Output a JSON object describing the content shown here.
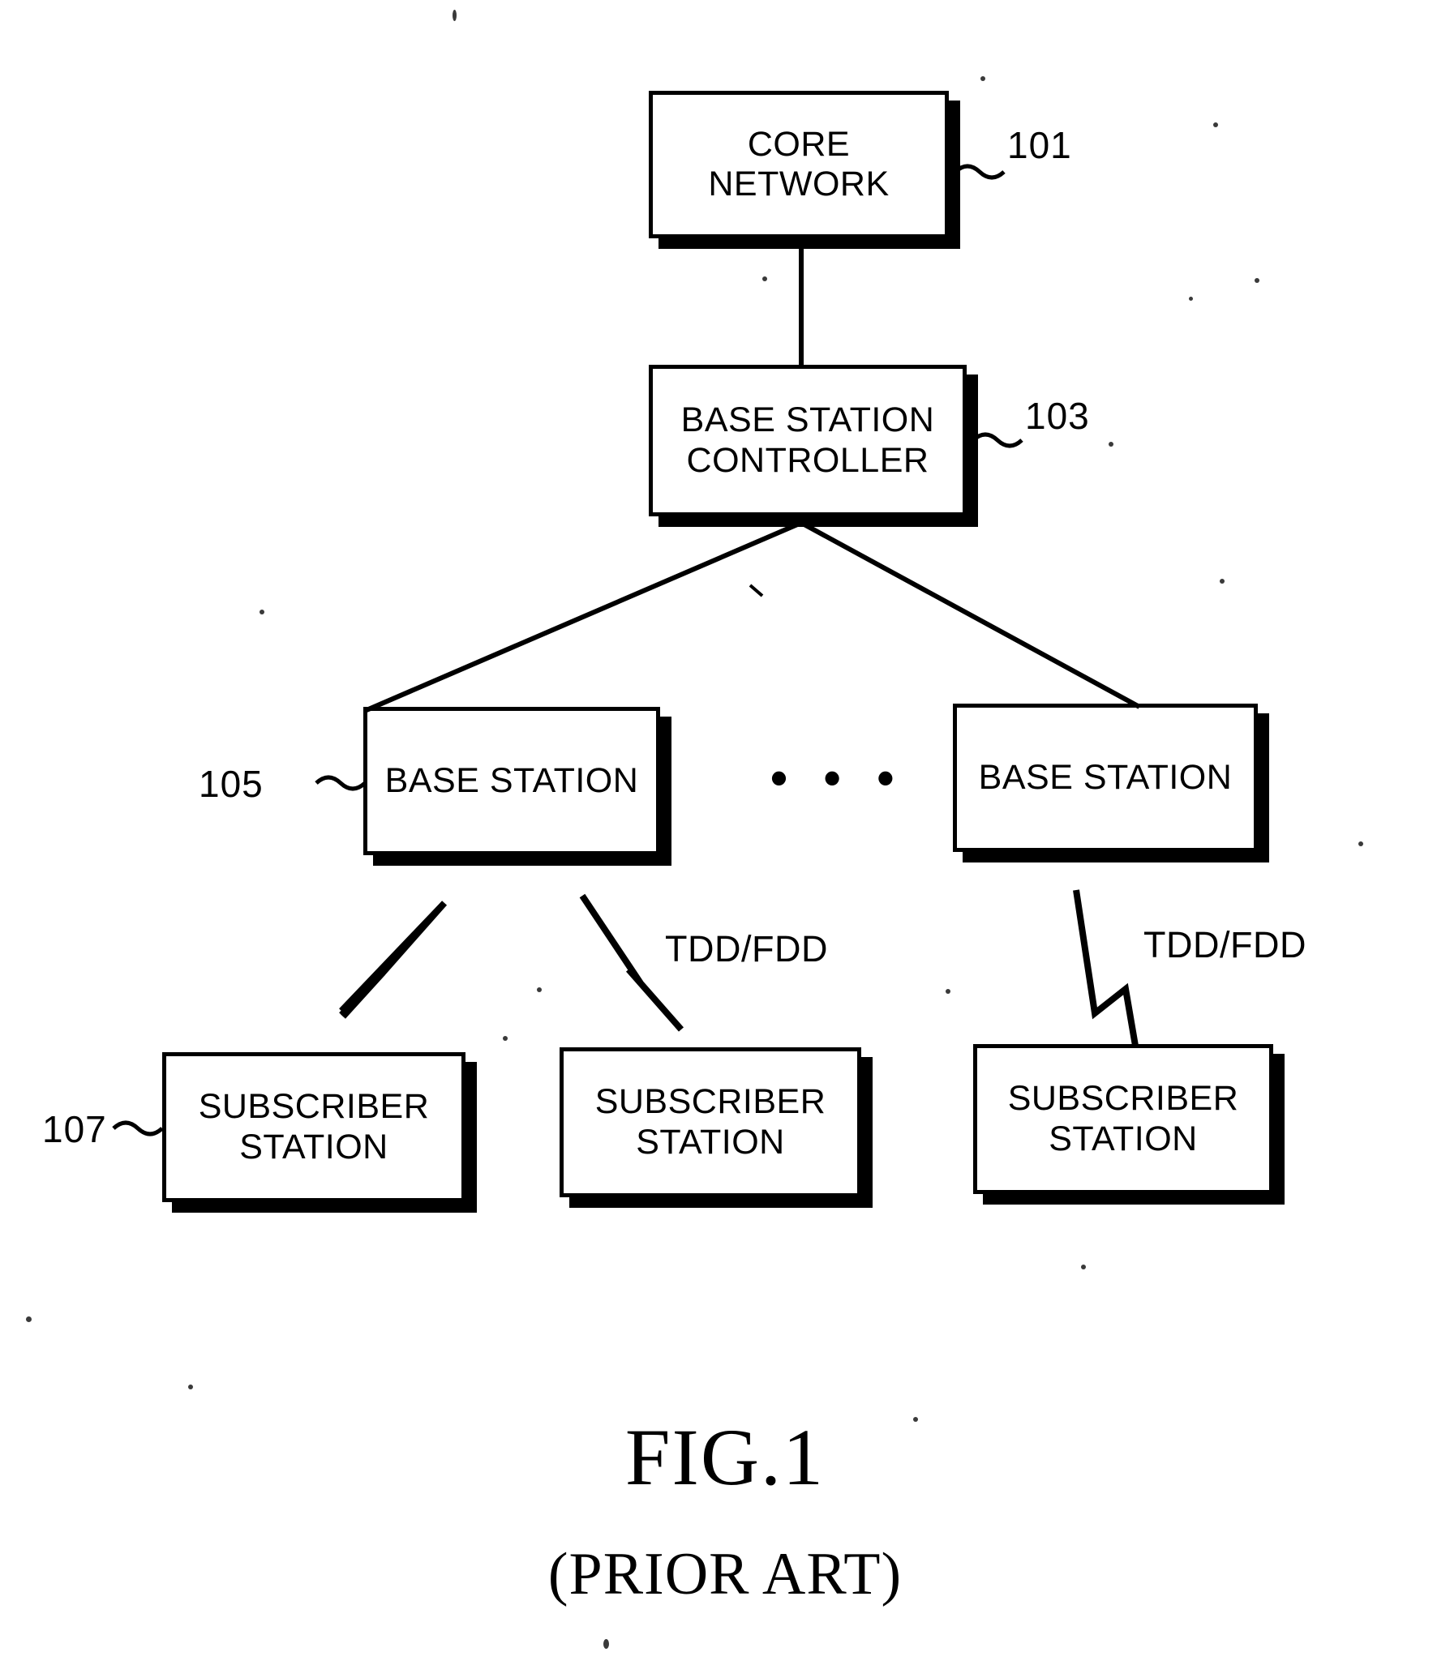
{
  "figure": {
    "title": "FIG.1",
    "subtitle": "(PRIOR ART)"
  },
  "diagram": {
    "type": "block-diagram",
    "nodes": [
      {
        "id": "core-network",
        "label": "CORE\nNETWORK",
        "ref": "101"
      },
      {
        "id": "base-station-controller",
        "label": "BASE STATION\nCONTROLLER",
        "ref": "103"
      },
      {
        "id": "base-station-left",
        "label": "BASE STATION",
        "ref": "105"
      },
      {
        "id": "base-station-right",
        "label": "BASE STATION",
        "ref": ""
      },
      {
        "id": "subscriber-station-left",
        "label": "SUBSCRIBER\nSTATION",
        "ref": "107"
      },
      {
        "id": "subscriber-station-middle",
        "label": "SUBSCRIBER\nSTATION",
        "ref": ""
      },
      {
        "id": "subscriber-station-right",
        "label": "SUBSCRIBER\nSTATION",
        "ref": ""
      }
    ],
    "refs": {
      "core_network": "101",
      "base_station_controller": "103",
      "base_station": "105",
      "subscriber_station": "107"
    },
    "ellipsis": "• • •",
    "link_labels": [
      {
        "id": "tdd-fdd-middle",
        "text": "TDD/FDD"
      },
      {
        "id": "tdd-fdd-right",
        "text": "TDD/FDD"
      }
    ],
    "colors": {
      "ink": "#000000",
      "paper": "#ffffff"
    }
  }
}
